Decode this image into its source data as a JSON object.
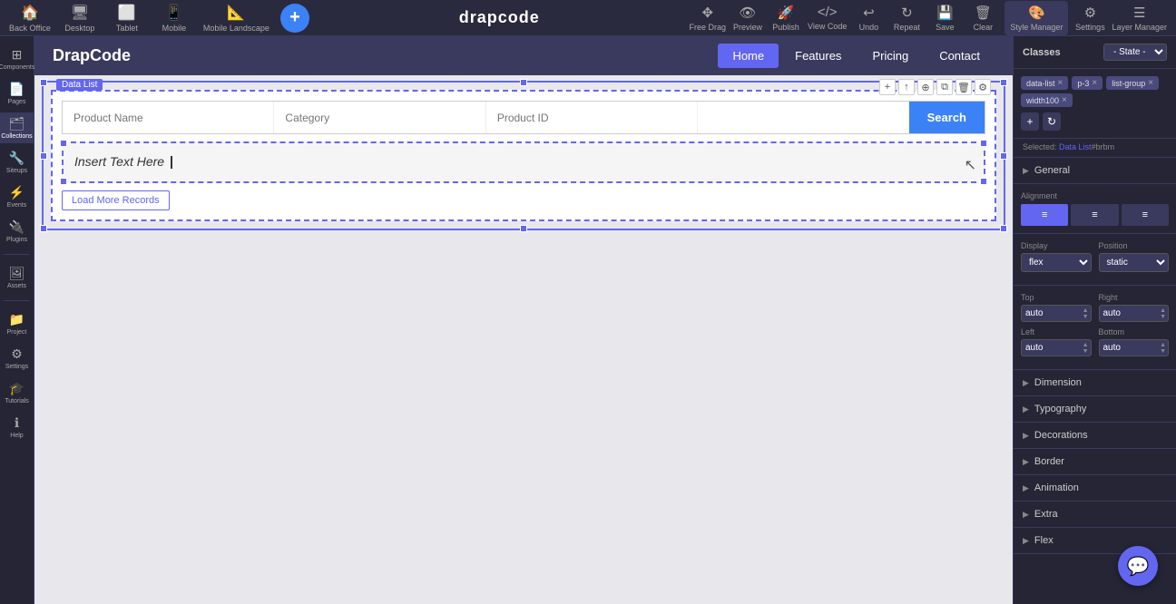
{
  "toolbar": {
    "logo": "drapcode",
    "add_icon": "+",
    "tools": [
      {
        "label": "Back Office",
        "icon": "🏠"
      },
      {
        "label": "Desktop",
        "icon": "🖥"
      },
      {
        "label": "Tablet",
        "icon": "⬜"
      },
      {
        "label": "Mobile",
        "icon": "📱"
      },
      {
        "label": "Mobile Landscape",
        "icon": "📐"
      }
    ],
    "actions": [
      {
        "label": "Free Drag",
        "icon": "✥"
      },
      {
        "label": "Preview",
        "icon": "👁"
      },
      {
        "label": "Publish",
        "icon": "🚀"
      },
      {
        "label": "View Code",
        "icon": "</>"
      },
      {
        "label": "Undo",
        "icon": "↩"
      },
      {
        "label": "Repeat",
        "icon": "↻"
      },
      {
        "label": "Save",
        "icon": "💾"
      },
      {
        "label": "Clear",
        "icon": "🗑"
      },
      {
        "label": "Style Manager",
        "icon": "🎨"
      },
      {
        "label": "Settings",
        "icon": "⚙"
      },
      {
        "label": "Layer Manager",
        "icon": "☰"
      }
    ]
  },
  "sidebar": {
    "items": [
      {
        "label": "Components",
        "icon": "⊞"
      },
      {
        "label": "Pages",
        "icon": "📄"
      },
      {
        "label": "Collections",
        "icon": "🗂"
      },
      {
        "label": "Siteups",
        "icon": "🔧"
      },
      {
        "label": "Events",
        "icon": "⚡"
      },
      {
        "label": "Plugins",
        "icon": "🔌"
      },
      {
        "label": "Assets",
        "icon": "🖼"
      },
      {
        "label": "Project",
        "icon": "📁"
      },
      {
        "label": "Settings",
        "icon": "⚙"
      },
      {
        "label": "Tutorials",
        "icon": "🎓"
      },
      {
        "label": "Help",
        "icon": "❓"
      }
    ]
  },
  "canvas": {
    "brand": "DrapCode",
    "nav_links": [
      {
        "label": "Home",
        "active": true
      },
      {
        "label": "Features",
        "active": false
      },
      {
        "label": "Pricing",
        "active": false
      },
      {
        "label": "Contact",
        "active": false
      }
    ],
    "data_list_label": "Data List",
    "search_placeholders": [
      "Product Name",
      "Category",
      "Product ID",
      ""
    ],
    "search_btn": "Search",
    "insert_text": "Insert Text Here",
    "load_more": "Load More Records"
  },
  "right_panel": {
    "title": "Classes",
    "state_label": "- State -",
    "classes": [
      "data-list",
      "p-3",
      "list-group",
      "width100"
    ],
    "selected_label": "Selected: Data List",
    "selected_extra": "#brbm",
    "alignment_label": "Alignment",
    "alignment_options": [
      "left",
      "center",
      "right"
    ],
    "display_label": "Display",
    "display_value": "flex",
    "position_label": "Position",
    "position_value": "static",
    "top_label": "Top",
    "top_value": "auto",
    "right_label": "Right",
    "right_value": "auto",
    "left_label": "Left",
    "left_value": "auto",
    "bottom_label": "Bottom",
    "bottom_value": "auto",
    "sections": [
      {
        "label": "General"
      },
      {
        "label": "Alignment"
      },
      {
        "label": "Dimension"
      },
      {
        "label": "Typography"
      },
      {
        "label": "Decorations"
      },
      {
        "label": "Border"
      },
      {
        "label": "Animation"
      },
      {
        "label": "Extra"
      },
      {
        "label": "Flex"
      }
    ]
  }
}
